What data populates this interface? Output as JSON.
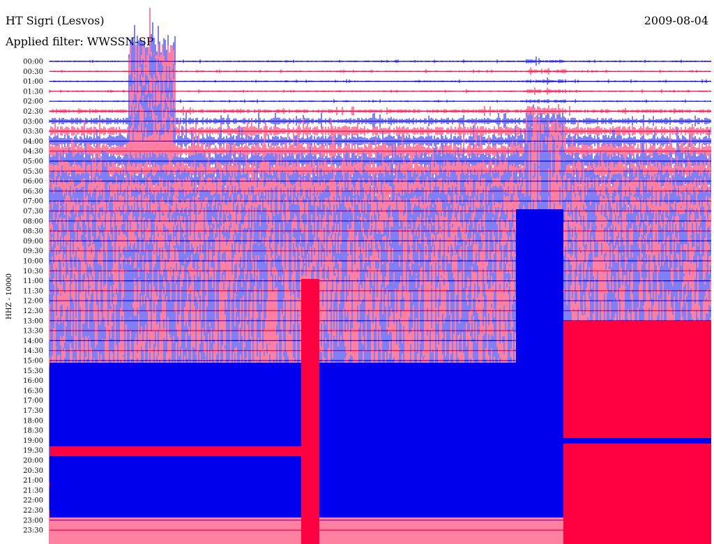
{
  "header": {
    "station": "HT Sigri (Lesvos)",
    "date": "2009-08-04",
    "filter_label": "Applied filter: WWSSN-SP"
  },
  "chart_data": {
    "type": "line",
    "title": "HT Sigri (Lesvos)",
    "subtitle": "Applied filter: WWSSN-SP",
    "ylabel": "HHZ - 10000",
    "xlabel": "",
    "grid": false,
    "rows": [
      "00:00",
      "00:30",
      "01:00",
      "01:30",
      "02:00",
      "02:30",
      "03:00",
      "03:30",
      "04:00",
      "04:30",
      "05:00",
      "05:30",
      "06:00",
      "06:30",
      "07:00",
      "07:30",
      "08:00",
      "08:30",
      "09:00",
      "09:30",
      "10:00",
      "10:30",
      "11:00",
      "11:30",
      "12:00",
      "12:30",
      "13:00",
      "13:30",
      "14:00",
      "14:30",
      "15:00",
      "15:30",
      "16:00",
      "16:30",
      "17:00",
      "17:30",
      "18:00",
      "18:30",
      "19:00",
      "19:30",
      "20:00",
      "20:30",
      "21:00",
      "21:30",
      "22:00",
      "22:30",
      "23:00",
      "23:30"
    ],
    "trace_colors": [
      "#0000ee",
      "#ff0040"
    ],
    "helicorder_minutes_per_line": 30
  }
}
